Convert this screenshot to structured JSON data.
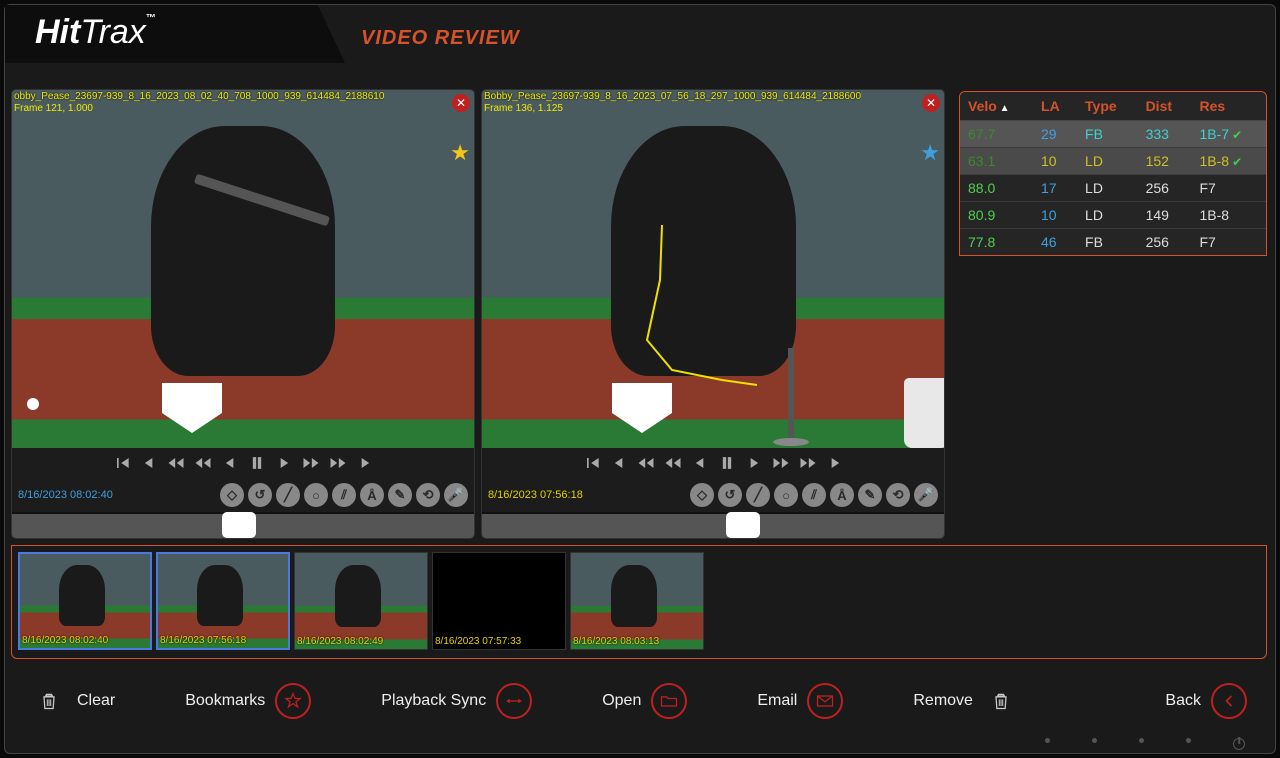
{
  "brand_hit": "Hit",
  "brand_trax": "Trax",
  "page_title": "VIDEO REVIEW",
  "video_left": {
    "filename": "obby_Pease_23697-939_8_16_2023_08_02_40_708_1000_939_614484_2188610",
    "frame_info": "Frame 121, 1.000",
    "timestamp": "8/16/2023  08:02:40"
  },
  "video_right": {
    "filename": "Bobby_Pease_23697-939_8_16_2023_07_56_18_297_1000_939_614484_2188600",
    "frame_info": "Frame 136, 1.125",
    "timestamp": "8/16/2023  07:56:18"
  },
  "table": {
    "headers": {
      "velo": "Velo",
      "la": "LA",
      "type": "Type",
      "dist": "Dist",
      "res": "Res"
    },
    "rows": [
      {
        "velo": "67.7",
        "la": "29",
        "type": "FB",
        "dist": "333",
        "res": "1B-7",
        "sel": "sel1",
        "check": true
      },
      {
        "velo": "63.1",
        "la": "10",
        "type": "LD",
        "dist": "152",
        "res": "1B-8",
        "sel": "sel2",
        "check": true
      },
      {
        "velo": "88.0",
        "la": "17",
        "type": "LD",
        "dist": "256",
        "res": "F7",
        "sel": "",
        "check": false
      },
      {
        "velo": "80.9",
        "la": "10",
        "type": "LD",
        "dist": "149",
        "res": "1B-8",
        "sel": "",
        "check": false
      },
      {
        "velo": "77.8",
        "la": "46",
        "type": "FB",
        "dist": "256",
        "res": "F7",
        "sel": "",
        "check": false
      }
    ]
  },
  "thumbs": [
    {
      "ts": "8/16/2023  08:02:40",
      "sel": true,
      "black": false
    },
    {
      "ts": "8/16/2023  07:56:18",
      "sel": true,
      "black": false
    },
    {
      "ts": "8/16/2023  08:02:49",
      "sel": false,
      "black": false
    },
    {
      "ts": "8/16/2023  07:57:33",
      "sel": false,
      "black": true
    },
    {
      "ts": "8/16/2023  08:03:13",
      "sel": false,
      "black": false
    }
  ],
  "buttons": {
    "clear": "Clear",
    "bookmarks": "Bookmarks",
    "playback": "Playback Sync",
    "open": "Open",
    "email": "Email",
    "remove": "Remove",
    "back": "Back"
  }
}
